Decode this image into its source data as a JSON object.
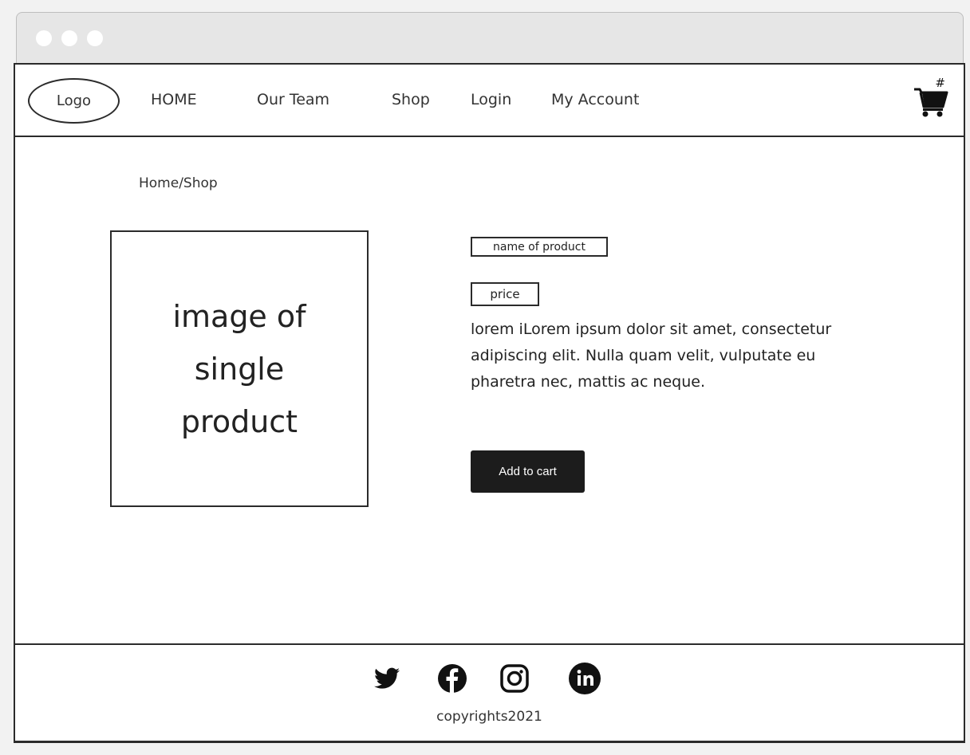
{
  "nav": {
    "logo": "Logo",
    "items": [
      "HOME",
      "Our Team",
      "Shop",
      "Login",
      "My Account"
    ],
    "cart_count": "#"
  },
  "breadcrumb": "Home/Shop",
  "product": {
    "image_placeholder": "image of single product",
    "name": "name of product",
    "price": "price",
    "description": "lorem iLorem ipsum dolor sit amet, consectetur adipiscing elit. Nulla quam velit, vulputate eu pharetra nec, mattis ac neque.",
    "add_to_cart_label": "Add to cart"
  },
  "footer": {
    "social_icons": [
      "twitter-icon",
      "facebook-icon",
      "instagram-icon",
      "linkedin-icon"
    ],
    "copyright": "copyrights2021"
  },
  "colors": {
    "border": "#2b2b2b",
    "button_bg": "#1c1c1c",
    "button_text": "#ffffff",
    "chrome_bg": "#e6e6e6"
  }
}
